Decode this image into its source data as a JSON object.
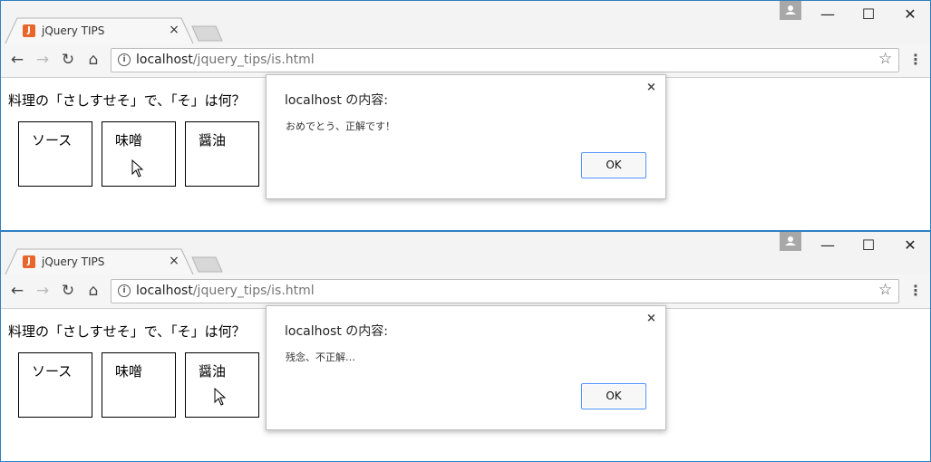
{
  "windows": [
    {
      "tab": {
        "title": "jQuery TIPS",
        "close": "×",
        "favicon": "jquery-favicon"
      },
      "controls": {
        "minimize": "—",
        "maximize": "☐",
        "close": "✕"
      },
      "nav": {
        "back": "←",
        "forward": "→",
        "reload": "↻",
        "home": "⌂"
      },
      "address": {
        "host": "localhost",
        "path": "/jquery_tips/is.html",
        "info": "i"
      },
      "star": "☆",
      "menu": "⋮",
      "page": {
        "question": "料理の「さしすせそ」で、「そ」は何？",
        "choices": [
          "ソース",
          "味噌",
          "醤油"
        ]
      },
      "dialog": {
        "title": "localhost の内容:",
        "message": "おめでとう、正解です！",
        "ok": "OK",
        "close": "×"
      }
    },
    {
      "tab": {
        "title": "jQuery TIPS",
        "close": "×",
        "favicon": "jquery-favicon"
      },
      "controls": {
        "minimize": "—",
        "maximize": "☐",
        "close": "✕"
      },
      "nav": {
        "back": "←",
        "forward": "→",
        "reload": "↻",
        "home": "⌂"
      },
      "address": {
        "host": "localhost",
        "path": "/jquery_tips/is.html",
        "info": "i"
      },
      "star": "☆",
      "menu": "⋮",
      "page": {
        "question": "料理の「さしすせそ」で、「そ」は何？",
        "choices": [
          "ソース",
          "味噌",
          "醤油"
        ]
      },
      "dialog": {
        "title": "localhost の内容:",
        "message": "残念、不正解…",
        "ok": "OK",
        "close": "×"
      }
    }
  ],
  "colors": {
    "window_border": "#2f80c2",
    "favicon": "#e8662b",
    "ok_border": "#4d90fe"
  }
}
